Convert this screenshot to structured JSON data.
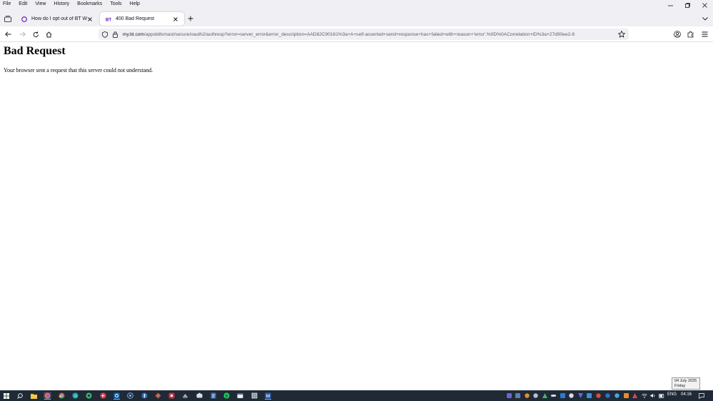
{
  "menubar": {
    "items": [
      "File",
      "Edit",
      "View",
      "History",
      "Bookmarks",
      "Tools",
      "Help"
    ]
  },
  "tabs": [
    {
      "title": "How do I opt out of BT Wi-fi? | BT",
      "active": false
    },
    {
      "title": "400 Bad Request",
      "active": true
    }
  ],
  "urlbar": {
    "host": "my.bt.com",
    "path": "/appsbillsmast/secure/oauth2/authresp?error=server_error&error_description=AAD82C90161%3a+A+self-asserted+send+response+has+failed+with+reason+'error'.%0D%0ACorrelation+ID%3a+27d90ee2-8"
  },
  "page": {
    "title": "Bad Request",
    "body": "Your browser sent a request that this server could not understand."
  },
  "tooltip": {
    "date": "04 July 2025",
    "day": "Friday"
  },
  "tray": {
    "language": "ENG",
    "time": "04:16"
  },
  "colors": {
    "chrome_bg": "#f0f0f4",
    "taskbar_bg": "#1f2a36",
    "accent": "#76b9ed"
  },
  "icons": {
    "taskbar_apps": [
      "start-icon",
      "search-icon",
      "file-explorer-icon",
      "firefox-icon",
      "chrome-icon",
      "edge-icon",
      "green-app-icon",
      "red-app-icon",
      "outlook-icon",
      "app-icon",
      "app-icon",
      "app-icon",
      "app-icon",
      "app-icon",
      "app-icon",
      "document-icon",
      "spotify-icon",
      "app-icon",
      "spreadsheet-icon",
      "word-icon"
    ]
  }
}
